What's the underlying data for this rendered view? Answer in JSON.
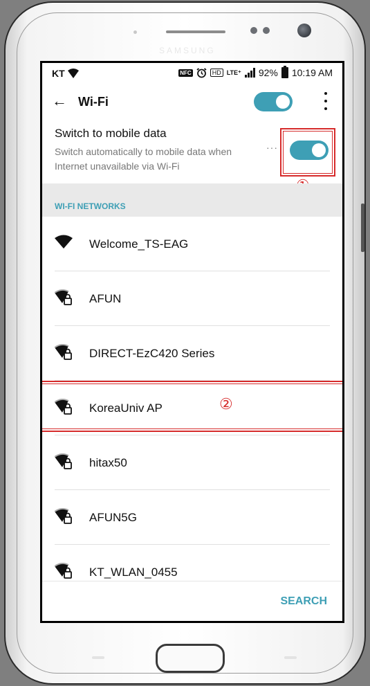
{
  "device": {
    "brand": "SAMSUNG"
  },
  "status_bar": {
    "carrier": "KT",
    "nfc": "NFC",
    "hd": "HD",
    "lte": "LTE⁺",
    "battery": "92%",
    "time": "10:19 AM"
  },
  "app_bar": {
    "title": "Wi-Fi",
    "wifi_enabled": true
  },
  "mobile_data": {
    "title": "Switch to mobile data",
    "description": "Switch automatically to mobile data when Internet unavailable via Wi-Fi",
    "more": "···",
    "enabled": true,
    "marker": "①"
  },
  "section_header": "WI-FI NETWORKS",
  "networks": [
    {
      "name": "Welcome_TS-EAG",
      "secured": false,
      "icon": "wifi-icon"
    },
    {
      "name": "AFUN",
      "secured": true,
      "icon": "wifi-lock-icon"
    },
    {
      "name": "DIRECT-EzC420 Series",
      "secured": true,
      "icon": "wifi-lock-icon"
    },
    {
      "name": "KoreaUniv AP",
      "secured": true,
      "icon": "wifi-lock-icon"
    },
    {
      "name": "hitax50",
      "secured": true,
      "icon": "wifi-lock-icon"
    },
    {
      "name": "AFUN5G",
      "secured": true,
      "icon": "wifi-lock-icon"
    },
    {
      "name": "KT_WLAN_0455",
      "secured": true,
      "icon": "wifi-lock-icon"
    }
  ],
  "highlight_marker": "②",
  "bottom_bar": {
    "search_label": "SEARCH"
  },
  "colors": {
    "accent": "#3e9fb5",
    "annotation": "#d62a2a",
    "section_bg": "#e9e9e9"
  }
}
